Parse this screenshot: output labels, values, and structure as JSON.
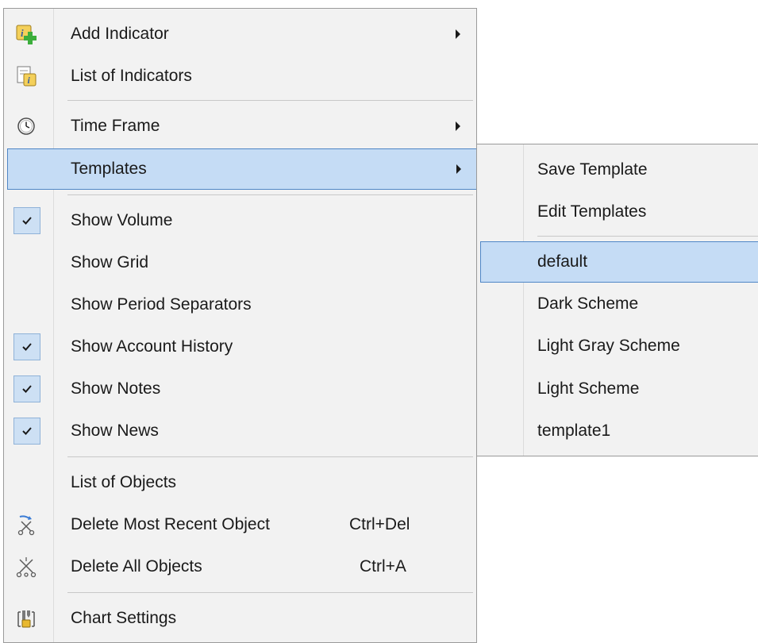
{
  "main_menu": {
    "items": [
      {
        "label": "Add Indicator",
        "icon": "add-indicator-icon",
        "submenu": true
      },
      {
        "label": "List of Indicators",
        "icon": "indicators-list-icon"
      },
      {
        "label": "Time Frame",
        "icon": "clock-icon",
        "submenu": true
      },
      {
        "label": "Templates",
        "submenu": true,
        "highlighted": true
      },
      {
        "label": "Show Volume",
        "checked": true
      },
      {
        "label": "Show Grid",
        "checked": false
      },
      {
        "label": "Show Period Separators",
        "checked": false
      },
      {
        "label": "Show Account History",
        "checked": true
      },
      {
        "label": "Show Notes",
        "checked": true
      },
      {
        "label": "Show News",
        "checked": true
      },
      {
        "label": "List of Objects"
      },
      {
        "label": "Delete Most Recent Object",
        "shortcut": "Ctrl+Del",
        "icon": "delete-recent-object-icon"
      },
      {
        "label": "Delete All Objects",
        "shortcut": "Ctrl+A",
        "icon": "delete-all-objects-icon"
      },
      {
        "label": "Chart Settings",
        "icon": "chart-settings-icon"
      }
    ]
  },
  "templates_submenu": {
    "items": [
      {
        "label": "Save Template"
      },
      {
        "label": "Edit Templates"
      },
      {
        "label": "default",
        "highlighted": true
      },
      {
        "label": "Dark Scheme"
      },
      {
        "label": "Light Gray Scheme"
      },
      {
        "label": "Light Scheme"
      },
      {
        "label": "template1"
      }
    ]
  },
  "colors": {
    "menu_background": "#f2f2f2",
    "highlight_fill": "#c5dcf5",
    "highlight_border": "#4f86c6",
    "check_box_fill": "#cde0f4"
  }
}
